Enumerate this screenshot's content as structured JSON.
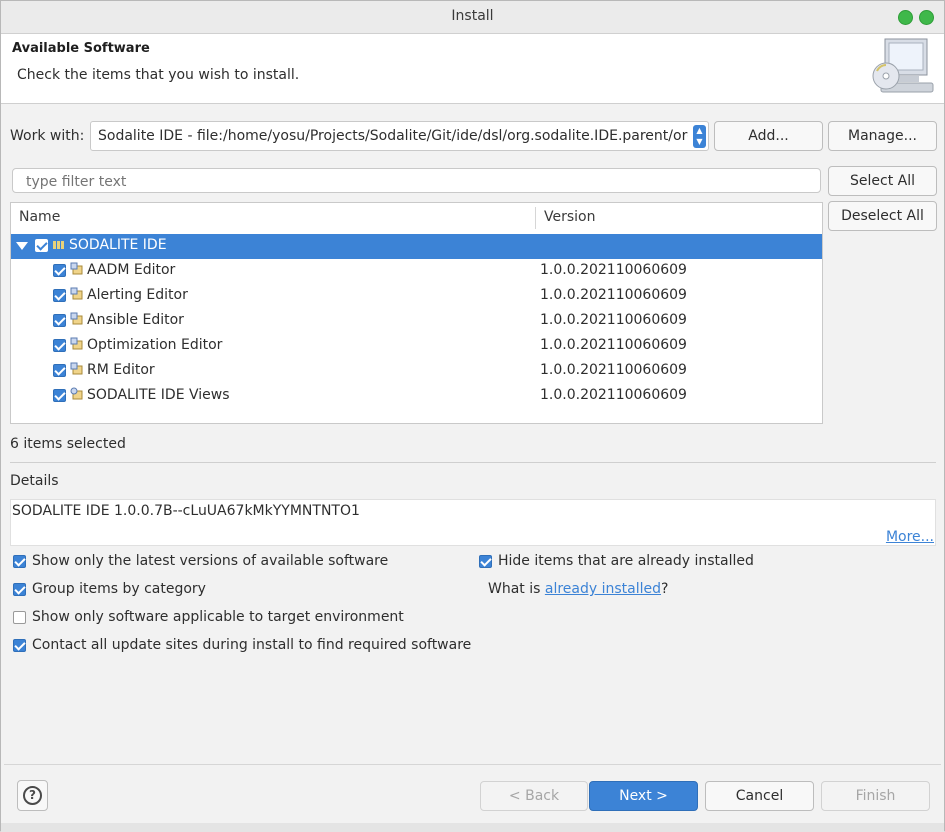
{
  "window": {
    "title": "Install"
  },
  "header": {
    "title": "Available Software",
    "description": "Check the items that you wish to install."
  },
  "work_with": {
    "label": "Work with:",
    "value": "Sodalite IDE - file:/home/yosu/Projects/Sodalite/Git/ide/dsl/org.sodalite.IDE.parent/org.sodalite.IDE.updatesite",
    "add_button": "Add...",
    "manage_button": "Manage..."
  },
  "filter": {
    "placeholder": "type filter text"
  },
  "side_buttons": {
    "select_all": "Select All",
    "deselect_all": "Deselect All"
  },
  "tree": {
    "columns": {
      "name": "Name",
      "version": "Version"
    },
    "category": {
      "label": "SODALITE IDE",
      "checked": true,
      "expanded": true
    },
    "items": [
      {
        "label": "AADM Editor",
        "version": "1.0.0.202110060609",
        "checked": true
      },
      {
        "label": "Alerting Editor",
        "version": "1.0.0.202110060609",
        "checked": true
      },
      {
        "label": "Ansible Editor",
        "version": "1.0.0.202110060609",
        "checked": true
      },
      {
        "label": "Optimization Editor",
        "version": "1.0.0.202110060609",
        "checked": true
      },
      {
        "label": "RM Editor",
        "version": "1.0.0.202110060609",
        "checked": true
      },
      {
        "label": "SODALITE IDE Views",
        "version": "1.0.0.202110060609",
        "checked": true
      }
    ]
  },
  "status": {
    "selected_text": "6 items selected"
  },
  "details": {
    "label": "Details",
    "text": "SODALITE IDE 1.0.0.7B--cLuUA67kMkYYMNTNTO1",
    "more_link": "More..."
  },
  "options": {
    "latest_versions": {
      "label": "Show only the latest versions of available software",
      "checked": true
    },
    "group_by_category": {
      "label": "Group items by category",
      "checked": true
    },
    "target_environment": {
      "label": "Show only software applicable to target environment",
      "checked": false
    },
    "contact_update_sites": {
      "label": "Contact all update sites during install to find required software",
      "checked": true
    },
    "hide_installed": {
      "label": "Hide items that are already installed",
      "checked": true
    },
    "what_is_prefix": "What is ",
    "already_installed_link": "already installed",
    "what_is_suffix": "?"
  },
  "footer": {
    "help_icon": "?",
    "back": "< Back",
    "next": "Next >",
    "cancel": "Cancel",
    "finish": "Finish"
  },
  "colors": {
    "accent": "#3c83d6",
    "window_bg": "#f2f2f2"
  },
  "icons": [
    "help-icon",
    "install-monitor-icon",
    "feature-icon",
    "category-icon",
    "expand-triangle-icon"
  ]
}
